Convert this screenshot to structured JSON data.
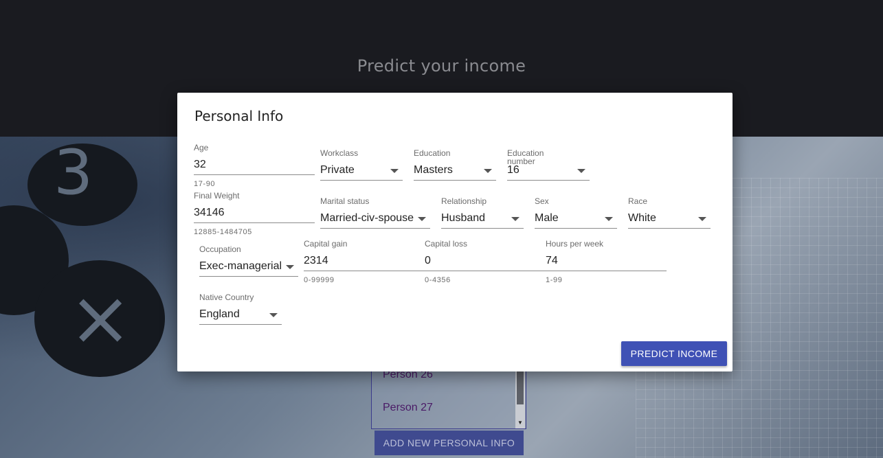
{
  "header": {
    "title": "Predict your income"
  },
  "background_list": {
    "items": [
      "Person 26",
      "Person 27"
    ],
    "add_button_label": "ADD NEW PERSONAL INFO"
  },
  "dialog": {
    "title": "Personal Info",
    "predict_button_label": "PREDICT INCOME",
    "fields": {
      "age": {
        "label": "Age",
        "value": "32",
        "hint": "17-90"
      },
      "workclass": {
        "label": "Workclass",
        "value": "Private"
      },
      "education": {
        "label": "Education",
        "value": "Masters"
      },
      "education_number": {
        "label": "Education number",
        "value": "16"
      },
      "final_weight": {
        "label": "Final Weight",
        "value": "34146",
        "hint": "12885-1484705"
      },
      "marital_status": {
        "label": "Marital status",
        "value": "Married-civ-spouse"
      },
      "relationship": {
        "label": "Relationship",
        "value": "Husband"
      },
      "sex": {
        "label": "Sex",
        "value": "Male"
      },
      "race": {
        "label": "Race",
        "value": "White"
      },
      "occupation": {
        "label": "Occupation",
        "value": "Exec-managerial"
      },
      "capital_gain": {
        "label": "Capital gain",
        "value": "2314",
        "hint": "0-99999"
      },
      "capital_loss": {
        "label": "Capital loss",
        "value": "0",
        "hint": "0-4356"
      },
      "hours_per_week": {
        "label": "Hours per week",
        "value": "74",
        "hint": "1-99"
      },
      "native_country": {
        "label": "Native Country",
        "value": "England"
      }
    }
  },
  "colors": {
    "primary_button": "#3f51b5",
    "header_bg": "#1a1b20",
    "list_text": "#4a1a66"
  }
}
